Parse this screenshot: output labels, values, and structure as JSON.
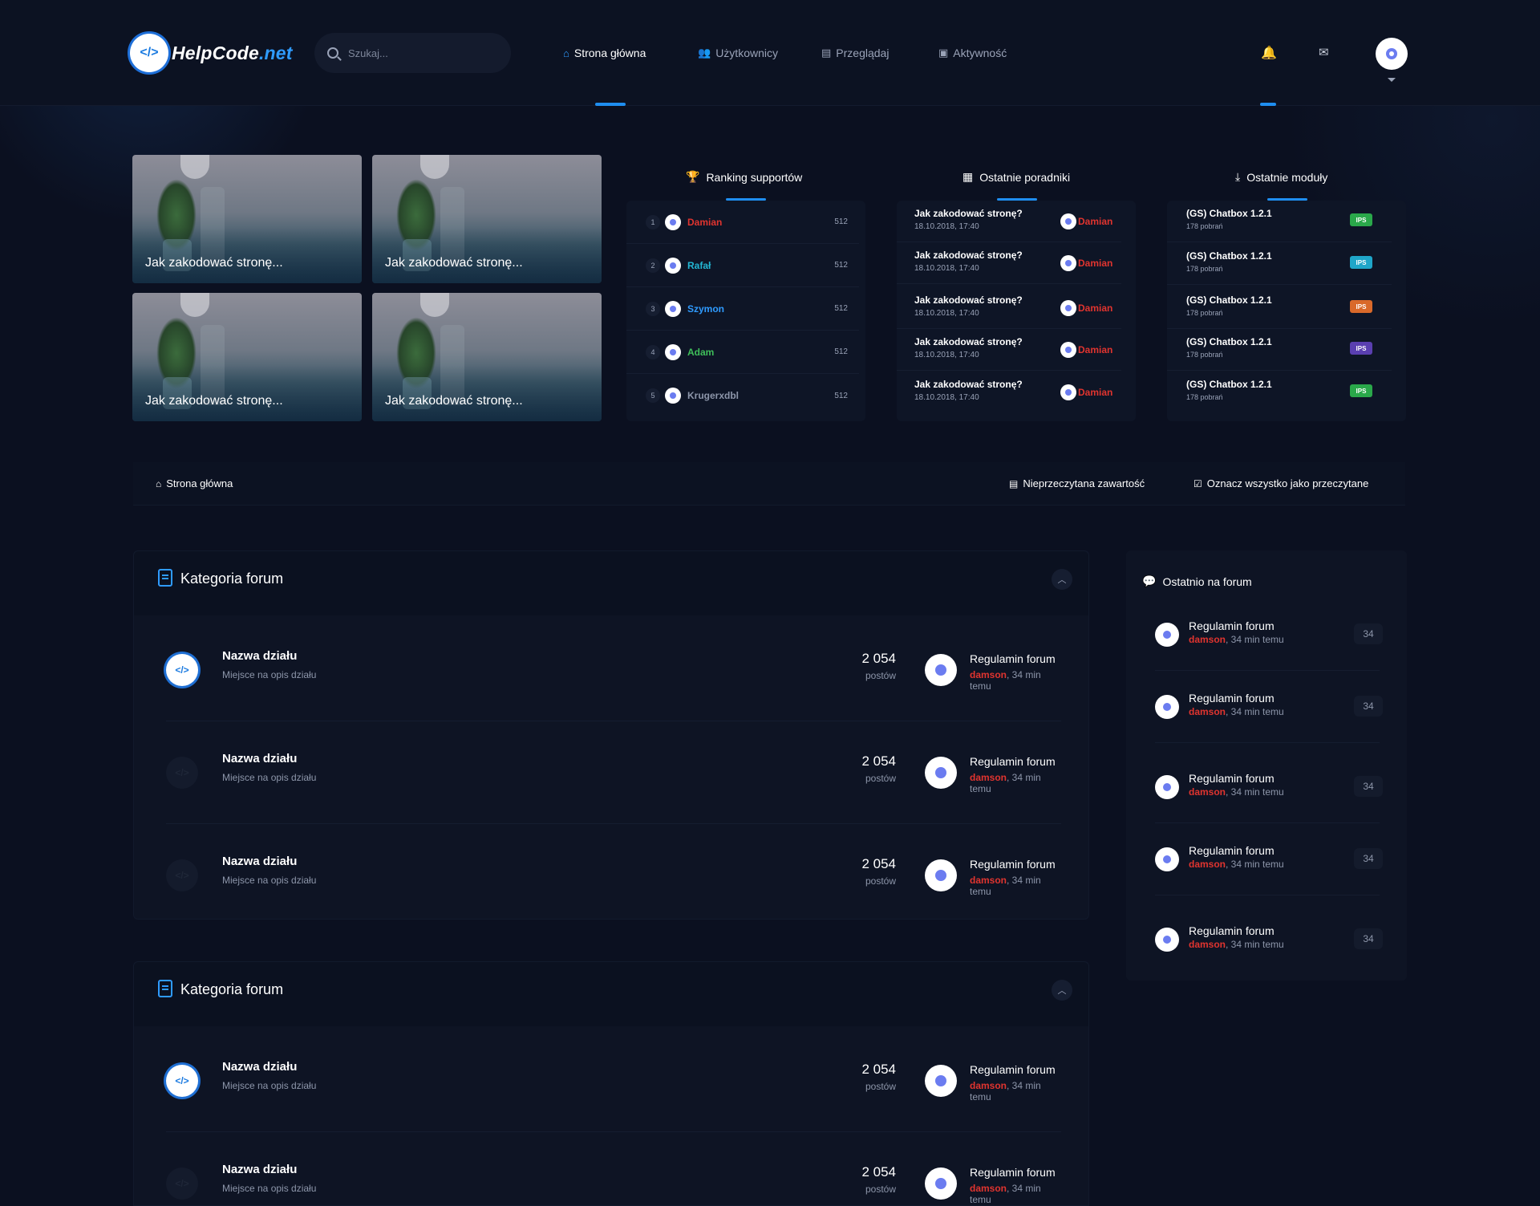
{
  "brand": {
    "name_prefix": "HelpCode",
    "name_suffix": ".net",
    "logo_glyph": "</>"
  },
  "search": {
    "placeholder": "Szukaj..."
  },
  "nav": [
    {
      "label": "Strona główna",
      "icon": "home-icon",
      "active": true
    },
    {
      "label": "Użytkownicy",
      "icon": "users-icon",
      "active": false
    },
    {
      "label": "Przeglądaj",
      "icon": "browse-icon",
      "active": false
    },
    {
      "label": "Aktywność",
      "icon": "activity-icon",
      "active": false
    }
  ],
  "header_icons": [
    "bell-icon",
    "mail-icon"
  ],
  "featured": [
    {
      "title": "Jak zakodować stronę..."
    },
    {
      "title": "Jak zakodować stronę..."
    },
    {
      "title": "Jak zakodować stronę..."
    },
    {
      "title": "Jak zakodować stronę..."
    }
  ],
  "ranking": {
    "title": "Ranking supportów",
    "rows": [
      {
        "rank": "1",
        "name": "Damian",
        "color": "#e0342f",
        "score": "512"
      },
      {
        "rank": "2",
        "name": "Rafał",
        "color": "#23b7d4",
        "score": "512"
      },
      {
        "rank": "3",
        "name": "Szymon",
        "color": "#2f9bff",
        "score": "512"
      },
      {
        "rank": "4",
        "name": "Adam",
        "color": "#3fbf5a",
        "score": "512"
      },
      {
        "rank": "5",
        "name": "Krugerxdbl",
        "color": "#8d96aa",
        "score": "512"
      }
    ]
  },
  "tutorials": {
    "title": "Ostatnie poradniki",
    "rows": [
      {
        "title": "Jak zakodować stronę?",
        "date": "18.10.2018, 17:40",
        "user": "Damian"
      },
      {
        "title": "Jak zakodować stronę?",
        "date": "18.10.2018, 17:40",
        "user": "Damian"
      },
      {
        "title": "Jak zakodować stronę?",
        "date": "18.10.2018, 17:40",
        "user": "Damian"
      },
      {
        "title": "Jak zakodować stronę?",
        "date": "18.10.2018, 17:40",
        "user": "Damian"
      },
      {
        "title": "Jak zakodować stronę?",
        "date": "18.10.2018, 17:40",
        "user": "Damian"
      }
    ]
  },
  "modules": {
    "title": "Ostatnie moduły",
    "rows": [
      {
        "title": "(GS) Chatbox 1.2.1",
        "sub": "178 pobrań",
        "badge": "IPS",
        "badge_color": "#2aa84a"
      },
      {
        "title": "(GS) Chatbox 1.2.1",
        "sub": "178 pobrań",
        "badge": "IPS",
        "badge_color": "#1fa6c9"
      },
      {
        "title": "(GS) Chatbox 1.2.1",
        "sub": "178 pobrań",
        "badge": "IPS",
        "badge_color": "#d9692a"
      },
      {
        "title": "(GS) Chatbox 1.2.1",
        "sub": "178 pobrań",
        "badge": "IPS",
        "badge_color": "#5a3fb0"
      },
      {
        "title": "(GS) Chatbox 1.2.1",
        "sub": "178 pobrań",
        "badge": "IPS",
        "badge_color": "#2aa84a"
      }
    ]
  },
  "breadcrumb": {
    "home": "Strona główna",
    "unread": "Nieprzeczytana zawartość",
    "mark_read": "Oznacz wszystko jako przeczytane"
  },
  "categories": [
    {
      "title": "Kategoria forum",
      "forums": [
        {
          "name": "Nazwa działu",
          "desc": "Miejsce na opis działu",
          "count": "2 054",
          "count_label": "postów",
          "last_title": "Regulamin forum",
          "last_user": "damson",
          "last_time": ", 34 min temu",
          "unread": true
        },
        {
          "name": "Nazwa działu",
          "desc": "Miejsce na opis działu",
          "count": "2 054",
          "count_label": "postów",
          "last_title": "Regulamin forum",
          "last_user": "damson",
          "last_time": ", 34 min temu",
          "unread": false
        },
        {
          "name": "Nazwa działu",
          "desc": "Miejsce na opis działu",
          "count": "2 054",
          "count_label": "postów",
          "last_title": "Regulamin forum",
          "last_user": "damson",
          "last_time": ", 34 min temu",
          "unread": false
        }
      ]
    },
    {
      "title": "Kategoria forum",
      "forums": [
        {
          "name": "Nazwa działu",
          "desc": "Miejsce na opis działu",
          "count": "2 054",
          "count_label": "postów",
          "last_title": "Regulamin forum",
          "last_user": "damson",
          "last_time": ", 34 min temu",
          "unread": true
        },
        {
          "name": "Nazwa działu",
          "desc": "Miejsce na opis działu",
          "count": "2 054",
          "count_label": "postów",
          "last_title": "Regulamin forum",
          "last_user": "damson",
          "last_time": ", 34 min temu",
          "unread": false
        }
      ]
    }
  ],
  "recent": {
    "title": "Ostatnio na forum",
    "rows": [
      {
        "title": "Regulamin forum",
        "user": "damson",
        "time": ", 34 min temu",
        "count": "34"
      },
      {
        "title": "Regulamin forum",
        "user": "damson",
        "time": ", 34 min temu",
        "count": "34"
      },
      {
        "title": "Regulamin forum",
        "user": "damson",
        "time": ", 34 min temu",
        "count": "34"
      },
      {
        "title": "Regulamin forum",
        "user": "damson",
        "time": ", 34 min temu",
        "count": "34"
      },
      {
        "title": "Regulamin forum",
        "user": "damson",
        "time": ", 34 min temu",
        "count": "34"
      }
    ]
  },
  "colors": {
    "accent": "#1f8ef0",
    "user_red": "#e0342f",
    "background": "#0b1020"
  }
}
